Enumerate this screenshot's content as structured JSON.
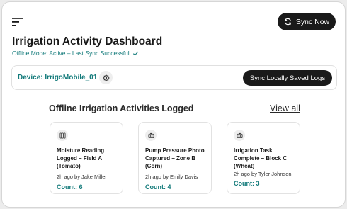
{
  "header": {
    "sync_now_label": "Sync Now",
    "title": "Irrigation Activity Dashboard",
    "status": "Offline Mode: Active – Last Sync Successful"
  },
  "device": {
    "label": "Device: IrrigoMobile_01",
    "sync_local_label": "Sync Locally Saved Logs"
  },
  "activities": {
    "section_title": "Offline Irrigation Activities Logged",
    "view_all_label": "View all",
    "cards": [
      {
        "icon": "moisture-sensor-icon",
        "title": "Moisture Reading Logged – Field A (Tomato)",
        "meta": "2h ago by Jake Miller",
        "count": "Count: 6"
      },
      {
        "icon": "camera-icon",
        "title": "Pump Pressure Photo Captured – Zone B (Corn)",
        "meta": "2h ago by Emily Davis",
        "count": "Count: 4"
      },
      {
        "icon": "camera-icon",
        "title": "Irrigation Task Complete – Block C (Wheat)",
        "meta": "2h ago by Tyler Johnson",
        "count": "Count: 3"
      }
    ]
  },
  "colors": {
    "accent": "#127a7a",
    "button": "#1a1a1a"
  }
}
